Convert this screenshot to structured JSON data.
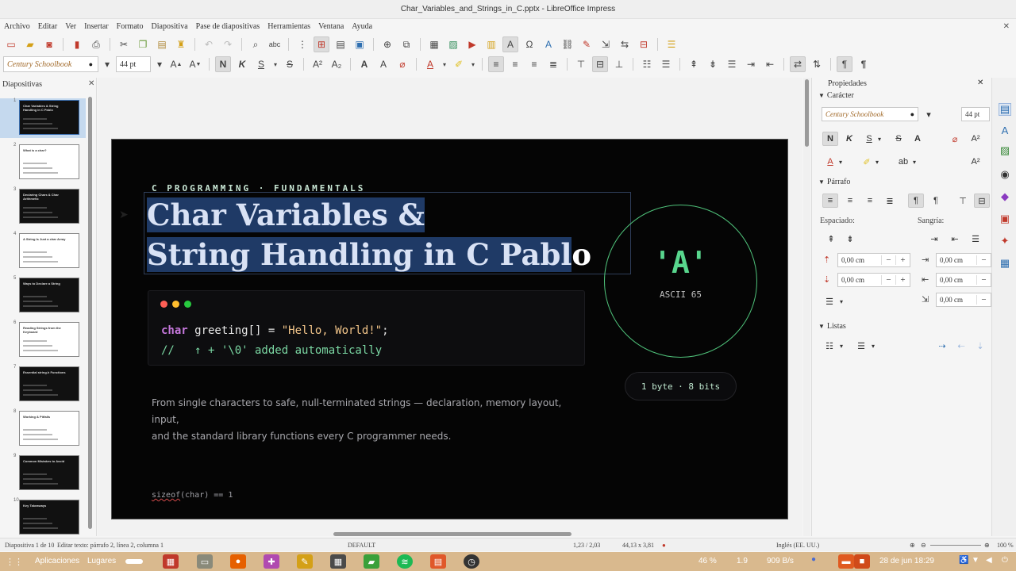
{
  "window": {
    "title": "Char_Variables_and_Strings_in_C.pptx - LibreOffice Impress",
    "controls": [
      "–",
      "□",
      "✕"
    ]
  },
  "menu": {
    "items": [
      "Archivo",
      "Editar",
      "Ver",
      "Insertar",
      "Formato",
      "Diapositiva",
      "Pase de diapositivas",
      "Herramientas",
      "Ventana",
      "Ayuda"
    ],
    "close": "✕"
  },
  "format_bar": {
    "font_name": "Century Schoolbook",
    "font_size": "44 pt",
    "bold": "N",
    "italic": "K",
    "underline": "S",
    "strike": "S",
    "grow": "A",
    "shrink": "A"
  },
  "slides_panel": {
    "title": "Diapositivas",
    "close": "✕",
    "slides": [
      {
        "num": "1",
        "title": "Char Variables & String Handling in C Pablo",
        "theme": "dark",
        "selected": true
      },
      {
        "num": "2",
        "title": "What is a char?",
        "theme": "light",
        "selected": false
      },
      {
        "num": "3",
        "title": "Declaring Chars & Char Arithmetic",
        "theme": "dark",
        "selected": false
      },
      {
        "num": "4",
        "title": "A String Is Just a char Array",
        "theme": "light",
        "selected": false
      },
      {
        "num": "5",
        "title": "Ways to Declare a String",
        "theme": "dark",
        "selected": false
      },
      {
        "num": "6",
        "title": "Reading Strings from the Keyboard",
        "theme": "light",
        "selected": false
      },
      {
        "num": "7",
        "title": "Essential string.h Functions",
        "theme": "dark",
        "selected": false
      },
      {
        "num": "8",
        "title": "Working & Pitfalls",
        "theme": "light",
        "selected": false
      },
      {
        "num": "9",
        "title": "Common Mistakes to Avoid",
        "theme": "dark",
        "selected": false
      },
      {
        "num": "10",
        "title": "Key Takeaways",
        "theme": "dark",
        "selected": false
      }
    ]
  },
  "slide": {
    "kicker": "C PROGRAMMING · FUNDAMENTALS",
    "title_line1": "Char Variables &",
    "title_line2_sel": "String Handling in C Pabl",
    "title_line2_rest": "o",
    "code_kw": "char",
    "code_mid": " greeting[] = ",
    "code_str": "\"Hello, World!\"",
    "code_end": ";",
    "code_comment": "//   ↑ + '\\0' added automatically",
    "subtitle_line1": "From single characters to safe, null-terminated strings — declaration, memory layout, input,",
    "subtitle_line2": "and the standard library functions every C programmer needs.",
    "sizeof_fn": "sizeof",
    "sizeof_rest": "(char) == 1",
    "circle_char": "'A'",
    "circle_ascii": "ASCII 65",
    "pill": "1 byte · 8 bits",
    "colors": {
      "green": "#58d68d",
      "title": "#d9e2f5",
      "background": "#050505",
      "dot_red": "#ff5f56",
      "dot_yellow": "#ffbd2e",
      "dot_green": "#27c93f"
    }
  },
  "properties": {
    "title": "Propiedades",
    "close": "✕",
    "caracter": "Carácter",
    "font_name": "Century Schoolbook",
    "font_size": "44 pt",
    "bold": "N",
    "italic": "K",
    "underline": "S",
    "strike": "S",
    "shadow": "A",
    "parrafo": "Párrafo",
    "espaciado": "Espaciado:",
    "sangria": "Sangría:",
    "spacing_values": [
      "0,00 cm",
      "0,00 cm"
    ],
    "indent_values": [
      "0,00 cm",
      "0,00 cm",
      "0,00 cm"
    ],
    "listas": "Listas"
  },
  "status": {
    "slide_of": "Diapositiva 1 de 10",
    "edit_info": "Editar texto: párrafo 2, línea 2, columna 1",
    "layout": "DEFAULT",
    "position": "1,23 / 2,03",
    "size": "44,13 x 3,81",
    "language": "Inglés (EE. UU.)",
    "zoom": "100 %"
  },
  "taskbar": {
    "apps": "Aplicaciones",
    "places": "Lugares",
    "battery": "46 %",
    "display": "1.9",
    "net": "909 B/s",
    "datetime": "28 de jun  18:29"
  }
}
